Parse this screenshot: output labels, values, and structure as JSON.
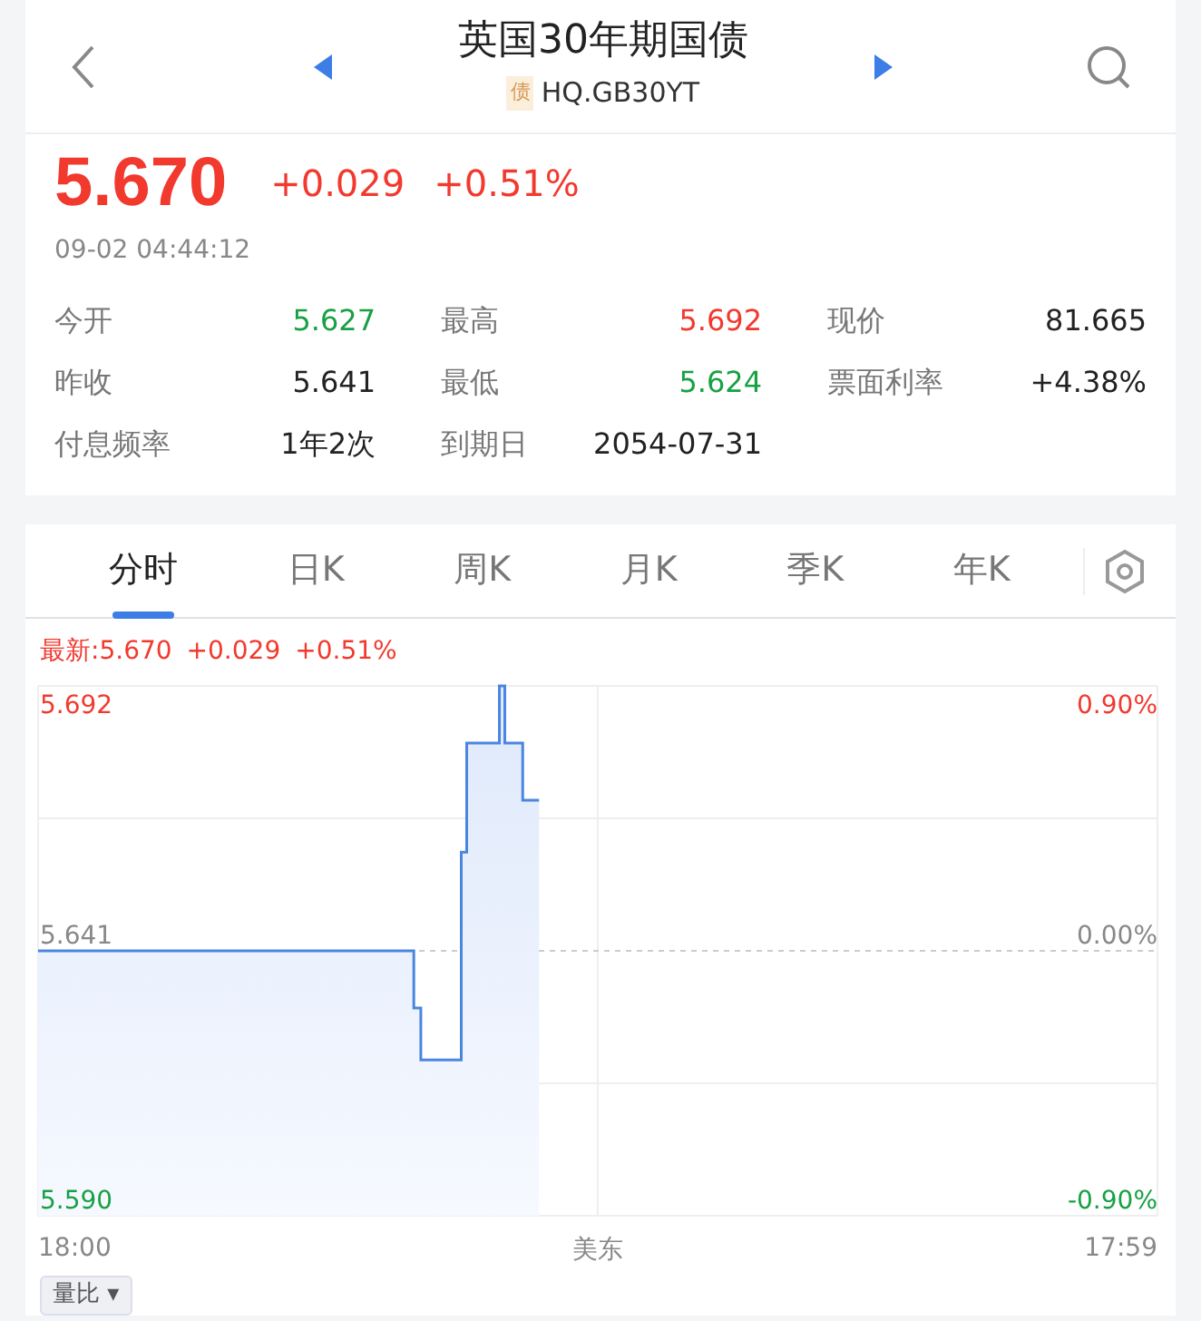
{
  "header": {
    "title": "英国30年期国债",
    "badge": "债",
    "code": "HQ.GB30YT"
  },
  "quote": {
    "price": "5.670",
    "change": "+0.029",
    "change_pct": "+0.51%",
    "time": "09-02 04:44:12",
    "color": "#f2392e"
  },
  "stats": [
    {
      "label": "今开",
      "value": "5.627",
      "color": "#18a144"
    },
    {
      "label": "最高",
      "value": "5.692",
      "color": "#f2392e"
    },
    {
      "label": "现价",
      "value": "81.665",
      "color": "#222222"
    },
    {
      "label": "昨收",
      "value": "5.641",
      "color": "#222222"
    },
    {
      "label": "最低",
      "value": "5.624",
      "color": "#18a144"
    },
    {
      "label": "票面利率",
      "value": "+4.38%",
      "color": "#222222"
    },
    {
      "label": "付息频率",
      "value": "1年2次",
      "color": "#222222"
    },
    {
      "label": "到期日",
      "value": "2054-07-31",
      "color": "#222222"
    }
  ],
  "tabs": [
    {
      "label": "分时",
      "selected": true
    },
    {
      "label": "日K",
      "selected": false
    },
    {
      "label": "周K",
      "selected": false
    },
    {
      "label": "月K",
      "selected": false
    },
    {
      "label": "季K",
      "selected": false
    },
    {
      "label": "年K",
      "selected": false
    }
  ],
  "chart": {
    "latest": [
      "最新:5.670",
      "+0.029",
      "+0.51%"
    ],
    "percent_labels": [
      {
        "label": "0.90%",
        "color": "#f2392e"
      },
      {
        "label": "0.00%",
        "color": "#888888"
      },
      {
        "label": "-0.90%",
        "color": "#18a144"
      }
    ],
    "time_labels": [
      "18:00",
      "17:59"
    ],
    "timezone": "美东",
    "price_labels": [
      {
        "label": "5.692",
        "color": "#f2392e"
      },
      {
        "label": "5.641",
        "color": "#888888"
      },
      {
        "label": "5.590",
        "color": "#18a144"
      }
    ]
  },
  "indicator": {
    "label": "量比",
    "caret": "▾"
  }
}
